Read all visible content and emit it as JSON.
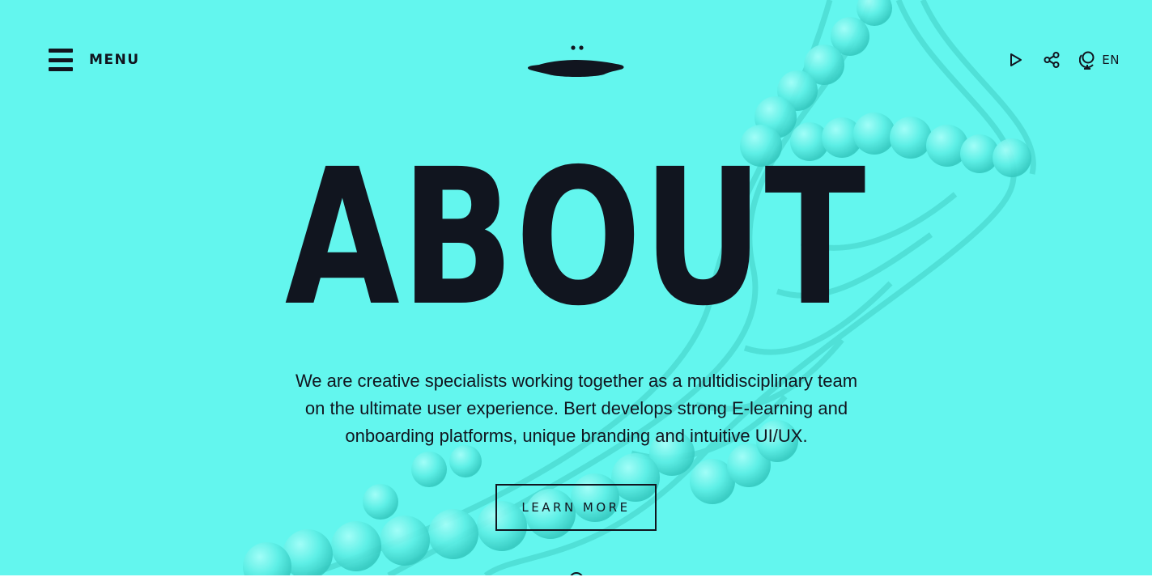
{
  "header": {
    "menu_label": "MENU",
    "lang_label": "EN",
    "icons": [
      "hamburger-icon",
      "logo-mark",
      "play-icon",
      "share-icon",
      "globe-icon"
    ]
  },
  "hero": {
    "title": "ABOUT",
    "intro": "We are creative specialists working together as a multidisciplinary team on the ultimate user experience. Bert develops strong E-learning and onboarding platforms, unique branding and intuitive UI/UX.",
    "cta_label": "LEARN MORE"
  },
  "colors": {
    "background": "#63f6ee",
    "text": "#11151f",
    "helix": "#4fe3da"
  }
}
